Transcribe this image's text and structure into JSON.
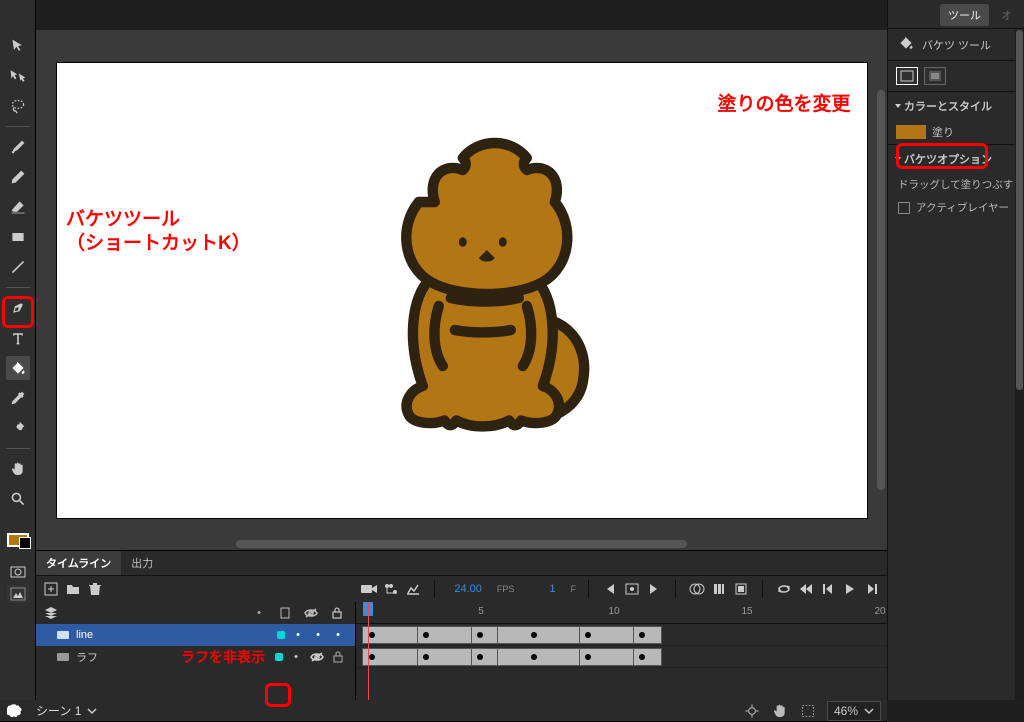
{
  "topbar": {
    "scene_label": "シーン 1",
    "zoom": "46%"
  },
  "right_panel": {
    "tab_tool": "ツール",
    "tab_other": "オ",
    "tool_name": "バケツ ツール",
    "sec_color_style": "カラーとスタイル",
    "fill_label": "塗り",
    "sec_bucket_opts": "バケツオプション",
    "drag_fill": "ドラッグして塗りつぶす",
    "active_layer": "アクティブレイヤー"
  },
  "annotations": {
    "bucket_tool": "バケツツール\n（ショートカットK）",
    "change_fill": "塗りの色を変更",
    "hide_rough": "ラフを非表示"
  },
  "timeline": {
    "tabs": {
      "timeline": "タイムライン",
      "output": "出力"
    },
    "fps_value": "24.00",
    "fps_label": "FPS",
    "frame_value": "1",
    "frame_label": "F",
    "layers": [
      {
        "name": "line",
        "color": "#00d8d8",
        "selected": true
      },
      {
        "name": "ラフ",
        "color": "#00d8d8",
        "selected": false,
        "hidden": true
      }
    ],
    "ruler_marks": [
      5,
      10,
      15,
      20
    ]
  },
  "colors": {
    "fill": "#b37614",
    "accent_red": "#ff0000"
  }
}
